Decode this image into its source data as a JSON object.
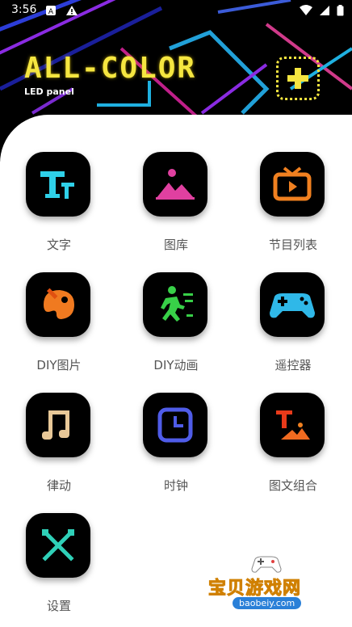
{
  "status_bar": {
    "time": "3:56",
    "left_icons": [
      "sim-icon",
      "warning-icon"
    ],
    "right_icons": [
      "wifi-icon",
      "signal-icon",
      "battery-icon"
    ]
  },
  "header": {
    "title": "ALL-COLOR",
    "subtitle": "LED panel",
    "add_button_icon": "plus-icon"
  },
  "grid": {
    "items": [
      {
        "label": "文字",
        "icon": "text-icon"
      },
      {
        "label": "图库",
        "icon": "gallery-icon"
      },
      {
        "label": "节目列表",
        "icon": "tv-icon"
      },
      {
        "label": "DIY图片",
        "icon": "palette-icon"
      },
      {
        "label": "DIY动画",
        "icon": "running-man-icon"
      },
      {
        "label": "遥控器",
        "icon": "gamepad-icon"
      },
      {
        "label": "律动",
        "icon": "music-note-icon"
      },
      {
        "label": "时钟",
        "icon": "clock-icon"
      },
      {
        "label": "图文组合",
        "icon": "text-image-icon"
      },
      {
        "label": "设置",
        "icon": "tools-icon"
      }
    ]
  },
  "watermark": {
    "text": "宝贝游戏网",
    "url": "baobeiy.com"
  },
  "colors": {
    "accent_yellow": "#f5e640",
    "tile_bg": "#000000",
    "label_color": "#555555"
  }
}
